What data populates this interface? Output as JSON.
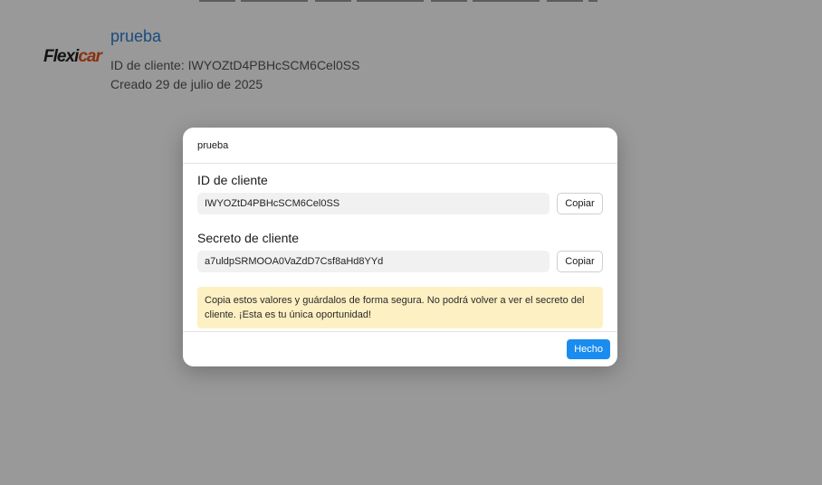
{
  "background": {
    "app": {
      "logo_text_a": "Flexi",
      "logo_text_b": "car",
      "name": "prueba",
      "client_id_line": "ID de cliente: IWYOZtD4PBHcSCM6Cel0SS",
      "created_line": "Creado 29 de julio de 2025"
    }
  },
  "modal": {
    "title": "prueba",
    "client_id": {
      "label": "ID de cliente",
      "value": "IWYOZtD4PBHcSCM6Cel0SS",
      "copy_label": "Copiar"
    },
    "client_secret": {
      "label": "Secreto de cliente",
      "value": "a7uldpSRMOOA0VaZdD7Csf8aHd8YYd",
      "copy_label": "Copiar"
    },
    "warning": "Copia estos valores y guárdalos de forma segura. No podrá volver a ver el secreto del cliente. ¡Esta es tu única oportunidad!",
    "done_label": "Hecho"
  },
  "colors": {
    "accent": "#1a8cf0",
    "link": "#2d7fd3",
    "warning_bg": "#fdf0c3",
    "logo_orange": "#e8541d"
  }
}
